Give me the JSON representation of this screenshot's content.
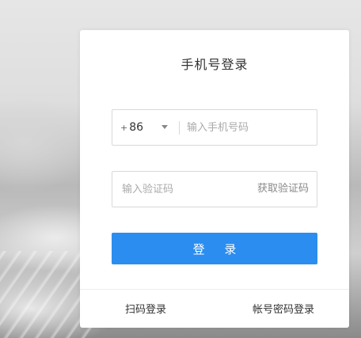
{
  "login": {
    "title": "手机号登录",
    "country_plus": "+",
    "country_code": "86",
    "phone_placeholder": "输入手机号码",
    "code_placeholder": "输入验证码",
    "get_code_label": "获取验证码",
    "login_button": "登 录",
    "qr_login_link": "扫码登录",
    "password_login_link": "帐号密码登录"
  },
  "colors": {
    "primary_button": "#2b8def",
    "card_background": "#ffffff"
  }
}
